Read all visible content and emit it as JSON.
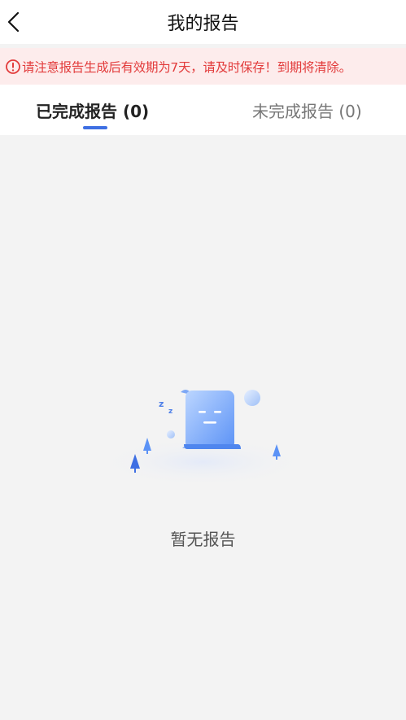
{
  "header": {
    "title": "我的报告",
    "back_icon": "chevron-left-icon"
  },
  "notice": {
    "icon": "alert-circle-icon",
    "text": "请注意报告生成后有效期为7天，请及时保存！到期将清除。",
    "color": "#e23b3b",
    "background": "#fdecec"
  },
  "tabs": [
    {
      "label": "已完成报告 (0)",
      "active": true
    },
    {
      "label": "未完成报告 (0)",
      "active": false
    }
  ],
  "accent_color": "#3e6fe3",
  "empty_state": {
    "illustration": "sleeping-document-icon",
    "text": "暂无报告"
  }
}
